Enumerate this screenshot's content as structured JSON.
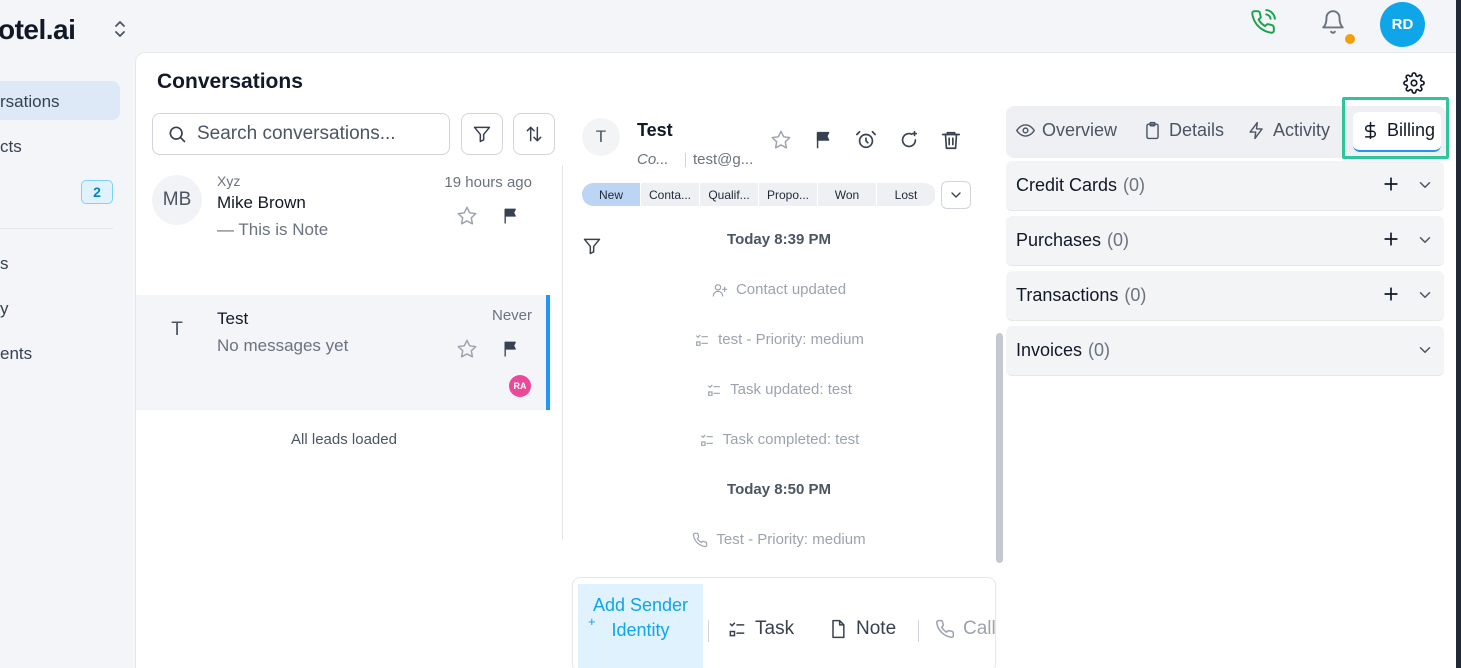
{
  "brand": {
    "logo_text": "otel.ai"
  },
  "topbar": {
    "avatar_initials": "RD"
  },
  "sidebar": {
    "items": [
      {
        "label": "rsations"
      },
      {
        "label": "cts"
      },
      {
        "label": "",
        "badge": "2"
      },
      {
        "label": "s"
      },
      {
        "label": "y"
      },
      {
        "label": "ents"
      }
    ]
  },
  "page": {
    "title": "Conversations"
  },
  "search": {
    "placeholder": "Search conversations..."
  },
  "conversations": [
    {
      "initials": "MB",
      "tag": "Xyz",
      "name": "Mike Brown",
      "preview": "—  This is Note",
      "time": "19 hours ago"
    },
    {
      "initials": "T",
      "name": "Test",
      "preview": "No messages yet",
      "time": "Never",
      "assignee": "RA"
    }
  ],
  "list_footer": "All leads loaded",
  "detail": {
    "initial": "T",
    "name": "Test",
    "subtitle_short": "Co...",
    "email_short": "test@g...",
    "stages": [
      "New",
      "Conta...",
      "Qualif...",
      "Propo...",
      "Won",
      "Lost"
    ],
    "active_stage": "New",
    "feed": [
      {
        "type": "date",
        "text": "Today 8:39 PM"
      },
      {
        "type": "event",
        "icon": "user-plus-icon",
        "text": "Contact updated"
      },
      {
        "type": "event",
        "icon": "task-list-icon",
        "text": "test  -  Priority: medium"
      },
      {
        "type": "event",
        "icon": "task-list-icon",
        "text": "Task updated: test"
      },
      {
        "type": "event",
        "icon": "task-list-icon",
        "text": "Task completed: test"
      },
      {
        "type": "date",
        "text": "Today 8:50 PM"
      },
      {
        "type": "event",
        "icon": "phone-icon",
        "text": "Test  -  Priority: medium"
      }
    ],
    "composer": {
      "add_sender": "Add Sender Identity",
      "task": "Task",
      "note": "Note",
      "call": "Call"
    }
  },
  "right_panel": {
    "tabs": [
      {
        "label": "Overview",
        "icon": "eye-icon"
      },
      {
        "label": "Details",
        "icon": "clipboard-icon"
      },
      {
        "label": "Activity",
        "icon": "lightning-icon"
      },
      {
        "label": "Billing",
        "icon": "dollar-icon"
      }
    ],
    "active_tab": "Billing",
    "sections": [
      {
        "title": "Credit Cards",
        "count": "(0)",
        "addable": true
      },
      {
        "title": "Purchases",
        "count": "(0)",
        "addable": true
      },
      {
        "title": "Transactions",
        "count": "(0)",
        "addable": true
      },
      {
        "title": "Invoices",
        "count": "(0)",
        "addable": false
      }
    ]
  },
  "colors": {
    "accent": "#2196f3",
    "highlight": "#2fc59b",
    "avatar": "#0ea5e9",
    "call_icon": "#16a34a"
  }
}
